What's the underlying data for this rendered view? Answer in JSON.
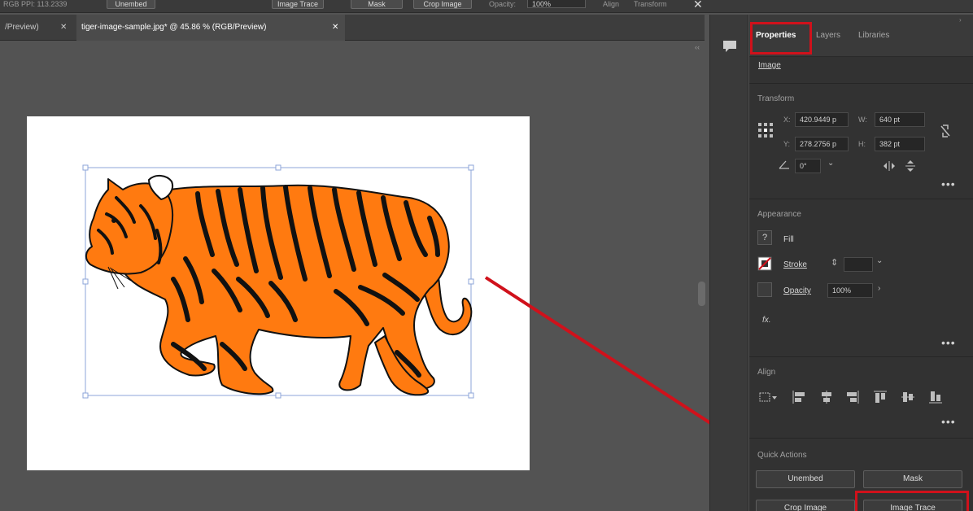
{
  "topbar": {
    "left_text": "RGB  PPI: 113.2339",
    "embed_button": "Unembed",
    "image_trace_button": "Image Trace",
    "mask_button": "Mask",
    "crop_image_button": "Crop Image",
    "opacity_label": "Opacity:",
    "opacity_value": "100%",
    "align_label": "Align",
    "transform_label": "Transform"
  },
  "tabs": {
    "prev_tab": "/Preview)",
    "active_tab": "tiger-image-sample.jpg* @ 45.86 % (RGB/Preview)"
  },
  "panel": {
    "tabs": [
      "Properties",
      "Layers",
      "Libraries"
    ],
    "object_type": "Image",
    "transform": {
      "title": "Transform",
      "x_label": "X:",
      "x_value": "420.9449 p",
      "y_label": "Y:",
      "y_value": "278.2756 p",
      "w_label": "W:",
      "w_value": "640 pt",
      "h_label": "H:",
      "h_value": "382 pt",
      "angle_value": "0°"
    },
    "appearance": {
      "title": "Appearance",
      "fill_label": "Fill",
      "stroke_label": "Stroke",
      "opacity_label": "Opacity",
      "opacity_value": "100%",
      "fx_label": "fx."
    },
    "align": {
      "title": "Align"
    },
    "quick_actions": {
      "title": "Quick Actions",
      "unembed": "Unembed",
      "mask": "Mask",
      "crop_image": "Crop Image",
      "image_trace": "Image Trace"
    }
  },
  "colors": {
    "highlight": "#d0111b",
    "arrow": "#d0111b",
    "tiger_orange": "#ff7a10",
    "selection": "#8ea6d8"
  }
}
